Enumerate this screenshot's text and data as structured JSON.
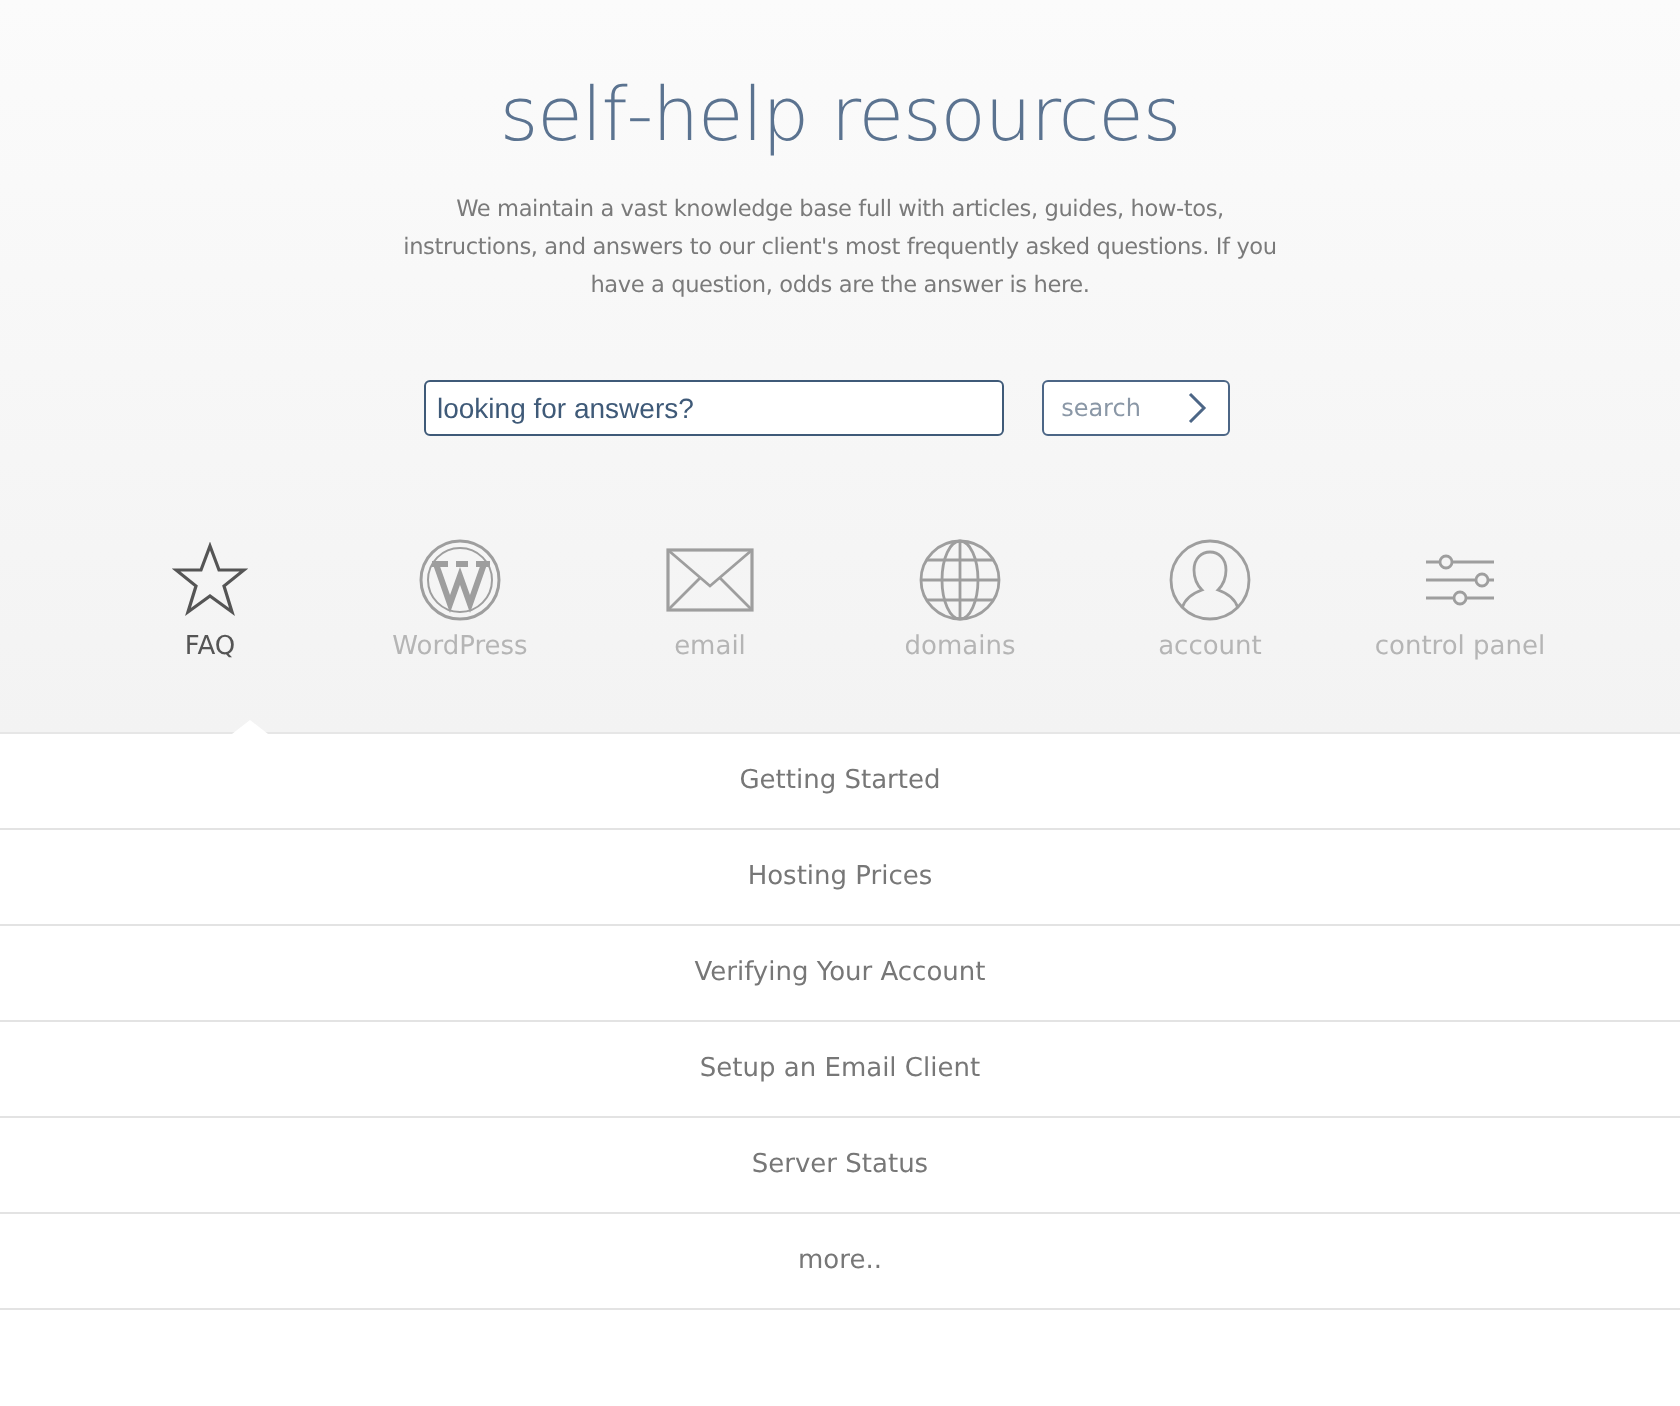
{
  "header": {
    "title": "self-help resources",
    "description": "We maintain a vast knowledge base full with articles, guides, how-tos, instructions, and answers to our client's most frequently asked questions. If you have a question, odds are the answer is here."
  },
  "search": {
    "value": "looking for answers?",
    "button": "search"
  },
  "categories": [
    {
      "label": "FAQ",
      "kind": "star",
      "selected": true
    },
    {
      "label": "WordPress",
      "kind": "wordpress",
      "selected": false
    },
    {
      "label": "email",
      "kind": "envelope",
      "selected": false
    },
    {
      "label": "domains",
      "kind": "globe",
      "selected": false
    },
    {
      "label": "account",
      "kind": "person",
      "selected": false
    },
    {
      "label": "control panel",
      "kind": "sliders",
      "selected": false
    }
  ],
  "links": [
    "Getting Started",
    "Hosting Prices",
    "Verifying Your Account",
    "Setup an Email Client",
    "Server Status",
    "more.."
  ]
}
